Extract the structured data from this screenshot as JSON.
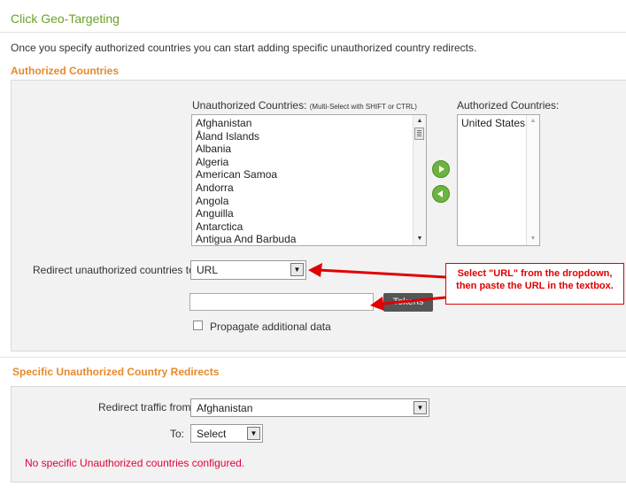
{
  "page": {
    "title": "Click Geo-Targeting",
    "intro": "Once you specify authorized countries you can start adding specific unauthorized country redirects."
  },
  "authorized_section": {
    "heading": "Authorized Countries",
    "unauthorized_label": "Unauthorized Countries:",
    "unauthorized_hint": "(Multi-Select with SHIFT or CTRL)",
    "unauthorized_list": [
      "Afghanistan",
      "Åland Islands",
      "Albania",
      "Algeria",
      "American Samoa",
      "Andorra",
      "Angola",
      "Anguilla",
      "Antarctica",
      "Antigua And Barbuda"
    ],
    "authorized_label": "Authorized Countries:",
    "authorized_list": [
      "United States"
    ],
    "add_button_icon": "arrow-right-icon",
    "remove_button_icon": "arrow-left-icon",
    "redirect_label": "Redirect unauthorized countries to:",
    "redirect_select_value": "URL",
    "url_input_value": "",
    "tokens_button": "Tokens",
    "propagate_label": "Propagate additional data",
    "propagate_checked": false
  },
  "annotation": {
    "text": "Select \"URL\" from the dropdown, then paste the URL in the textbox.",
    "color": "#e00000"
  },
  "specific_section": {
    "heading": "Specific Unauthorized Country Redirects",
    "redirect_from_label": "Redirect traffic from:",
    "redirect_from_value": "Afghanistan",
    "to_label": "To:",
    "to_value": "Select",
    "empty_message": "No specific Unauthorized countries configured."
  },
  "colors": {
    "title_green": "#6aa327",
    "section_orange": "#e8892a",
    "button_green": "#6cb33f",
    "error_red": "#e4003a"
  }
}
